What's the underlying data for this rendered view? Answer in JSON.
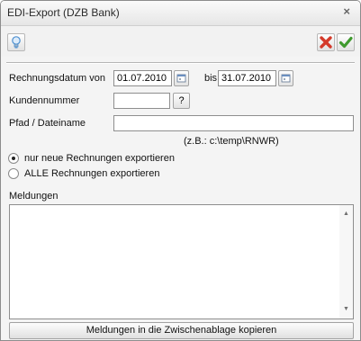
{
  "window": {
    "title": "EDI-Export (DZB Bank)",
    "close_glyph": "×"
  },
  "toolbar": {
    "hint_icon": "lightbulb-icon",
    "cancel_icon": "red-x-icon",
    "ok_icon": "green-check-icon"
  },
  "form": {
    "invoice_date_label": "Rechnungsdatum von",
    "date_from": "01.07.2010",
    "date_to_label": "bis",
    "date_to": "31.07.2010",
    "customer_number_label": "Kundennummer",
    "customer_number": "",
    "lookup_label": "?",
    "path_label": "Pfad / Dateiname",
    "path_value": "",
    "path_hint": "(z.B.: c:\\temp\\RNWR)"
  },
  "export_options": [
    {
      "label": "nur neue Rechnungen exportieren",
      "checked": true
    },
    {
      "label": "ALLE Rechnungen exportieren",
      "checked": false
    }
  ],
  "messages": {
    "label": "Meldungen",
    "content": ""
  },
  "copy_button_label": "Meldungen in die Zwischenablage kopieren",
  "colors": {
    "cancel_red": "#d43a2a",
    "ok_green": "#3f9a2e",
    "bulb_blue": "#4d8fcf"
  }
}
